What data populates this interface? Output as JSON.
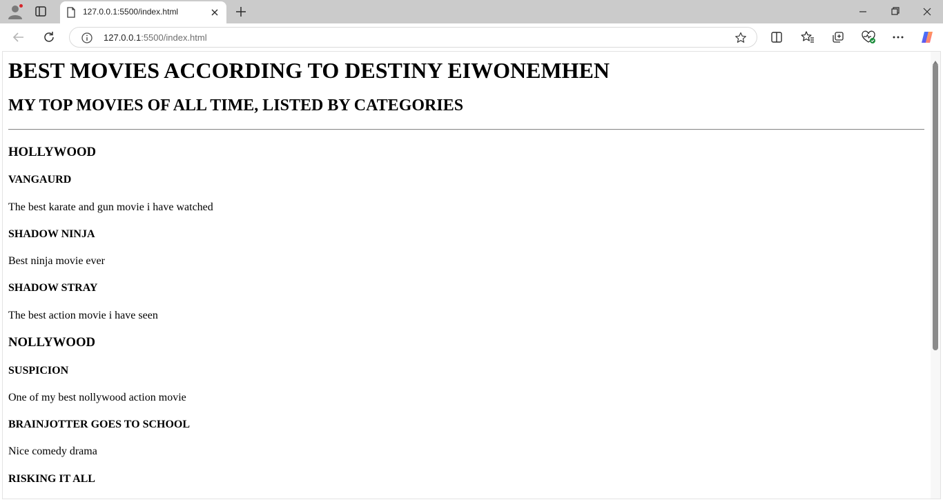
{
  "browser": {
    "tab": {
      "title": "127.0.0.1:5500/index.html",
      "favicon": "page-icon",
      "close_icon": "close-icon"
    },
    "new_tab_icon": "plus-icon",
    "window_controls": [
      "minimize-icon",
      "restore-icon",
      "close-icon"
    ],
    "address_bar": {
      "host": "127.0.0.1",
      "rest": ":5500/index.html",
      "info_icon": "info-icon"
    },
    "toolbar_icons": [
      "split-screen-icon",
      "favorites-icon",
      "collections-icon",
      "browser-essentials-icon",
      "more-icon",
      "copilot-icon"
    ],
    "profile_notification_color": "#d6262b",
    "accent_color": "#1a73e8"
  },
  "page": {
    "title": "BEST MOVIES ACCORDING TO DESTINY EIWONEMHEN",
    "subtitle": "MY TOP MOVIES OF ALL TIME, LISTED BY CATEGORIES",
    "categories": [
      {
        "name": "HOLLYWOOD",
        "movies": [
          {
            "title": "VANGAURD",
            "description": "The best karate and gun movie i have watched"
          },
          {
            "title": "SHADOW NINJA",
            "description": "Best ninja movie ever"
          },
          {
            "title": "SHADOW STRAY",
            "description": "The best action movie i have seen"
          }
        ]
      },
      {
        "name": "NOLLYWOOD",
        "movies": [
          {
            "title": "SUSPICION",
            "description": "One of my best nollywood action movie"
          },
          {
            "title": "BRAINJOTTER GOES TO SCHOOL",
            "description": "Nice comedy drama"
          },
          {
            "title": "RISKING IT ALL"
          }
        ]
      }
    ]
  }
}
